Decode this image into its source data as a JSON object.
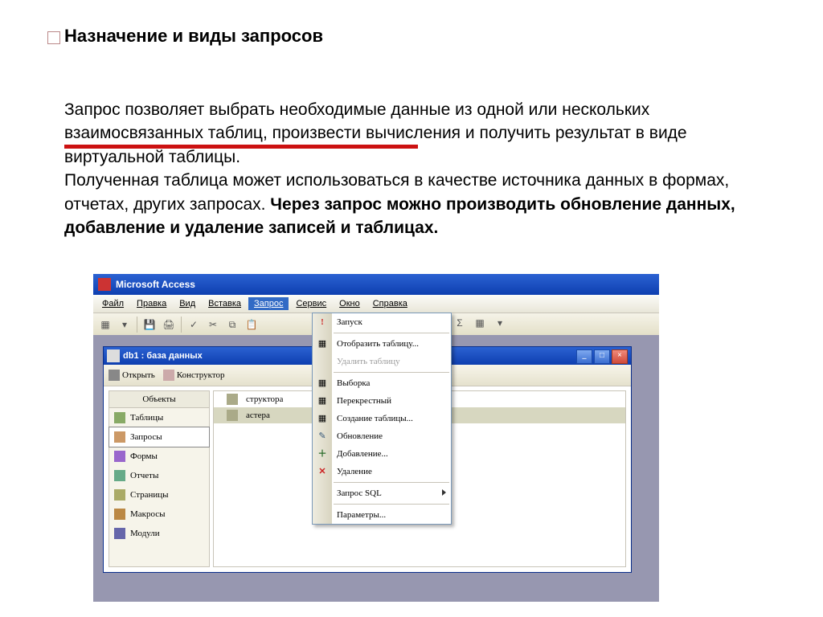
{
  "heading": "Назначение и виды запросов",
  "paragraph": {
    "p1": "Запрос позволяет выбрать необходимые данные из одной или нескольких взаимосвязанных таблиц, произвести вычисления и получить результат в виде виртуальной таблицы.",
    "p2": "Полученная таблица может использоваться в качестве источника данных в формах, отчетах, других запросах. ",
    "p3_bold": "Через запрос можно производить обновление данных, добавление и удаление записей и таблицах."
  },
  "app": {
    "title": "Microsoft Access",
    "menus": [
      "Файл",
      "Правка",
      "Вид",
      "Вставка",
      "Запрос",
      "Сервис",
      "Окно",
      "Справка"
    ],
    "active_menu_index": 4
  },
  "dropdown": [
    {
      "label": "Запуск",
      "icon": "!",
      "disabled": false
    },
    {
      "sep": true
    },
    {
      "label": "Отобразить таблицу...",
      "icon": "▦",
      "disabled": false,
      "u": 0
    },
    {
      "label": "Удалить таблицу",
      "icon": "",
      "disabled": true
    },
    {
      "sep": true
    },
    {
      "label": "Выборка",
      "icon": "▦",
      "disabled": false,
      "u": 0
    },
    {
      "label": "Перекрестный",
      "icon": "▦",
      "disabled": false,
      "u": 0
    },
    {
      "label": "Создание таблицы...",
      "icon": "▦",
      "disabled": false,
      "u": 0
    },
    {
      "label": "Обновление",
      "icon": "✎",
      "disabled": false,
      "u": 0
    },
    {
      "label": "Добавление...",
      "icon": "＋",
      "disabled": false,
      "u": 0
    },
    {
      "label": "Удаление",
      "icon": "✕",
      "disabled": false,
      "u": 0
    },
    {
      "sep": true
    },
    {
      "label": "Запрос SQL",
      "icon": "",
      "disabled": false,
      "arrow": true
    },
    {
      "sep": true
    },
    {
      "label": "Параметры...",
      "icon": "",
      "disabled": false,
      "u": 0
    }
  ],
  "child_window": {
    "title": "db1 : база данных",
    "toolbar": {
      "open": "Открыть",
      "design": "Конструктор"
    },
    "objects_header": "Объекты",
    "objects": [
      {
        "label": "Таблицы",
        "icon": "tbl"
      },
      {
        "label": "Запросы",
        "icon": "qry",
        "selected": true
      },
      {
        "label": "Формы",
        "icon": "frm"
      },
      {
        "label": "Отчеты",
        "icon": "rpt"
      },
      {
        "label": "Страницы",
        "icon": "pgs"
      },
      {
        "label": "Макросы",
        "icon": "mcr"
      },
      {
        "label": "Модули",
        "icon": "mdl"
      }
    ],
    "main_items": [
      {
        "label_tail": "структора"
      },
      {
        "label_tail": "астера",
        "selected": true
      }
    ]
  }
}
